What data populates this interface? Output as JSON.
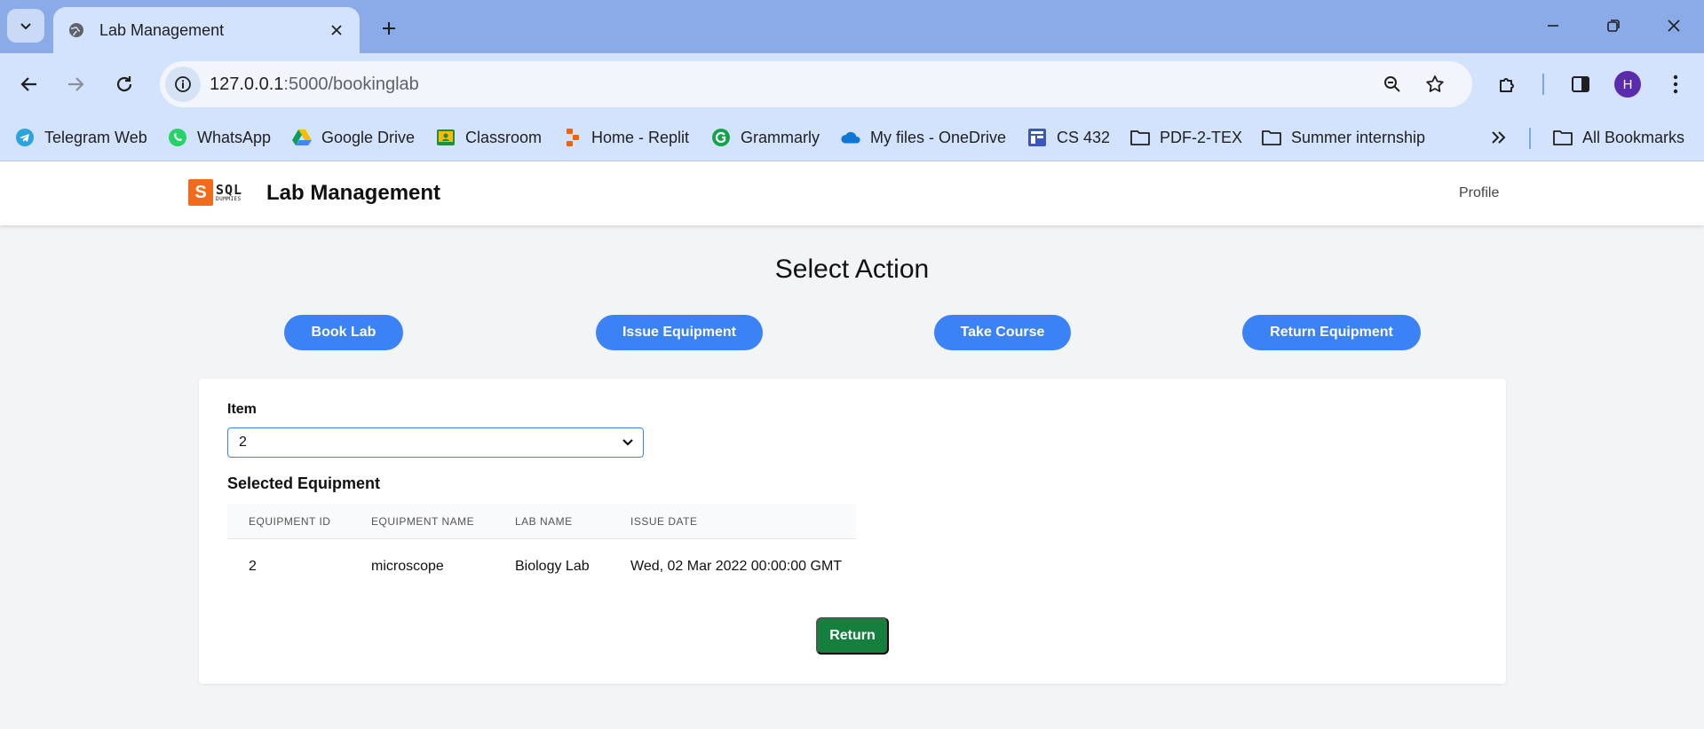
{
  "browser": {
    "tab_title": "Lab Management",
    "url_host": "127.0.0.1",
    "url_path": ":5000/bookinglab",
    "profile_initial": "H",
    "bookmarks": [
      {
        "label": "Telegram Web",
        "icon": "telegram-icon"
      },
      {
        "label": "WhatsApp",
        "icon": "whatsapp-icon"
      },
      {
        "label": "Google Drive",
        "icon": "google-drive-icon"
      },
      {
        "label": "Classroom",
        "icon": "classroom-icon"
      },
      {
        "label": "Home - Replit",
        "icon": "replit-icon"
      },
      {
        "label": "Grammarly",
        "icon": "grammarly-icon"
      },
      {
        "label": "My files - OneDrive",
        "icon": "onedrive-icon"
      },
      {
        "label": "CS 432",
        "icon": "course-icon"
      },
      {
        "label": "PDF-2-TEX",
        "icon": "folder-icon"
      },
      {
        "label": "Summer internship",
        "icon": "folder-icon"
      }
    ],
    "all_bookmarks": "All Bookmarks"
  },
  "app": {
    "logo_letter": "S",
    "logo_word": "SQL",
    "logo_sub": "DUMMIES",
    "title": "Lab Management",
    "profile_link": "Profile"
  },
  "main": {
    "heading": "Select Action",
    "actions": [
      "Book Lab",
      "Issue Equipment",
      "Take Course",
      "Return Equipment"
    ],
    "item_label": "Item",
    "item_value": "2",
    "selected_heading": "Selected Equipment",
    "table": {
      "headers": [
        "EQUIPMENT ID",
        "EQUIPMENT NAME",
        "LAB NAME",
        "ISSUE DATE"
      ],
      "rows": [
        [
          "2",
          "microscope",
          "Biology Lab",
          "Wed, 02 Mar 2022 00:00:00 GMT"
        ]
      ]
    },
    "return_label": "Return"
  },
  "colors": {
    "primary": "#3b82f6",
    "success": "#15803d",
    "logo_orange": "#f26b1d",
    "chrome_frame": "#8aabe8",
    "chrome_toolbar": "#d3e3fd"
  }
}
